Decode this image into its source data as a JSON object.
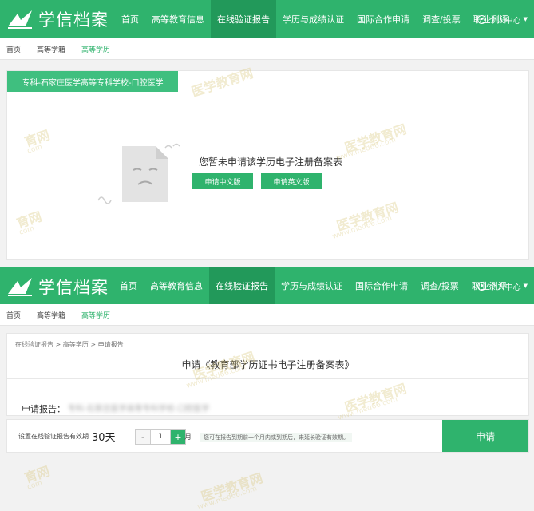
{
  "site": {
    "logo_text": "学信档案"
  },
  "nav": {
    "items": [
      "首页",
      "高等教育信息",
      "在线验证报告",
      "学历与成绩认证",
      "国际合作申请",
      "调查/投票",
      "职业测评"
    ],
    "active_index": 2,
    "user_center": "个人中心"
  },
  "breadcrumb": {
    "items": [
      "首页",
      "高等学籍",
      "高等学历"
    ],
    "active_index": 2
  },
  "top": {
    "school_tab": "专科-石家庄医学高等专科学校-口腔医学",
    "empty_message": "您暂未申请该学历电子注册备案表",
    "btn_cn": "申请中文版",
    "btn_en": "申请英文版"
  },
  "bottom": {
    "sub_breadcrumb": "在线验证报告 > 高等学历 > 申请报告",
    "title": "申请《教育部学历证书电子注册备案表》",
    "report_label": "申请报告：",
    "report_value_blurred": "专科-石家庄医学高等专科学校-口腔医学",
    "validity_label": "设置在线验证报告有效期",
    "validity_days": "30天",
    "stepper_minus": "-",
    "stepper_value": "1",
    "stepper_plus": "+",
    "stepper_unit": "月",
    "hint": "您可在报告到期前一个月内或到期后，来延长验证有效期。",
    "apply_button": "申请"
  },
  "watermark": {
    "main": "医学教育网",
    "url": "www.med66.com",
    "side": "育网",
    "side_small": "com"
  },
  "colors": {
    "brand_green": "#2fb36d",
    "active_nav": "#22995a",
    "tab_green": "#3fbf7f"
  }
}
